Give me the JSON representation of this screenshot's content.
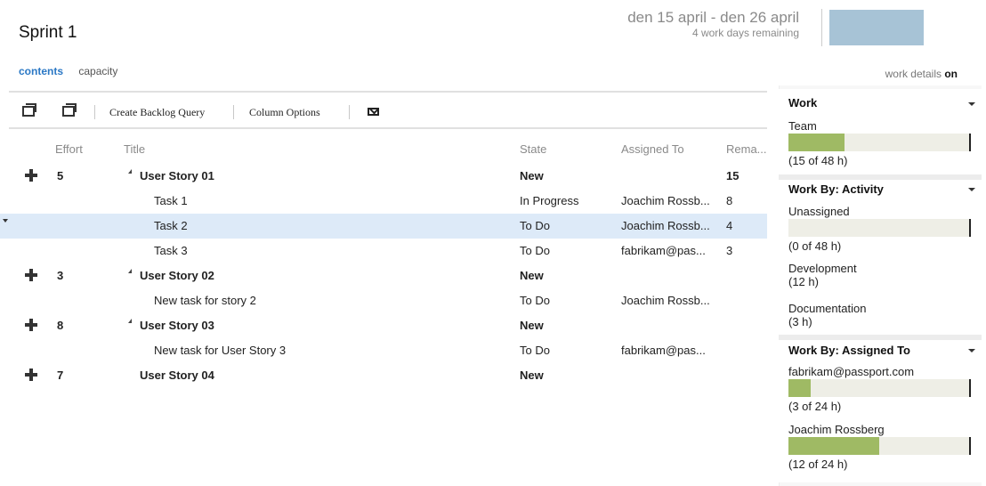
{
  "header": {
    "sprint_title": "Sprint 1",
    "date_range": "den 15 april - den 26 april",
    "days_remaining": "4 work days remaining"
  },
  "tabs": [
    {
      "label": "contents",
      "active": true
    },
    {
      "label": "capacity",
      "active": false
    }
  ],
  "work_details": {
    "label": "work details",
    "state": "on"
  },
  "toolbar": {
    "create_backlog_query": "Create Backlog Query",
    "column_options": "Column Options"
  },
  "columns": {
    "effort": "Effort",
    "title": "Title",
    "state": "State",
    "assigned_to": "Assigned To",
    "remaining": "Rema..."
  },
  "rows": [
    {
      "type": "story",
      "effort": "5",
      "title": "User Story 01",
      "state": "New",
      "assigned": "",
      "remaining": "15"
    },
    {
      "type": "task",
      "effort": "",
      "title": "Task 1",
      "state": "In Progress",
      "assigned": "Joachim Rossb...",
      "remaining": "8"
    },
    {
      "type": "task",
      "effort": "",
      "title": "Task 2",
      "state": "To Do",
      "assigned": "Joachim Rossb...",
      "remaining": "4",
      "selected": true
    },
    {
      "type": "task",
      "effort": "",
      "title": "Task 3",
      "state": "To Do",
      "assigned": "fabrikam@pas...",
      "remaining": "3"
    },
    {
      "type": "story",
      "effort": "3",
      "title": "User Story 02",
      "state": "New",
      "assigned": "",
      "remaining": ""
    },
    {
      "type": "task",
      "effort": "",
      "title": "New task for story 2",
      "state": "To Do",
      "assigned": "Joachim Rossb...",
      "remaining": ""
    },
    {
      "type": "story",
      "effort": "8",
      "title": "User Story 03",
      "state": "New",
      "assigned": "",
      "remaining": ""
    },
    {
      "type": "task",
      "effort": "",
      "title": "New task for User Story 3",
      "state": "To Do",
      "assigned": "fabrikam@pas...",
      "remaining": ""
    },
    {
      "type": "story",
      "effort": "7",
      "title": "User Story 04",
      "state": "New",
      "assigned": "",
      "remaining": ""
    }
  ],
  "work_panel": {
    "work": {
      "title": "Work",
      "team_label": "Team",
      "team_caption": "(15 of 48 h)",
      "team_fraction": 0.3125
    },
    "activity": {
      "title": "Work By: Activity",
      "unassigned_label": "Unassigned",
      "unassigned_caption": "(0 of 48 h)",
      "unassigned_fraction": 0,
      "development_label": "Development",
      "development_hours": "(12 h)",
      "documentation_label": "Documentation",
      "documentation_hours": "(3 h)"
    },
    "assigned": {
      "title": "Work By: Assigned To",
      "person1_name": "fabrikam@passport.com",
      "person1_caption": "(3 of 24 h)",
      "person1_fraction": 0.125,
      "person2_name": "Joachim Rossberg",
      "person2_caption": "(12 of 24 h)",
      "person2_fraction": 0.5
    }
  },
  "colors": {
    "accent_link": "#2b78c5",
    "bar_fill": "#9fba64",
    "burndown": "#a7c3d6",
    "selected_row": "#ddeaf8"
  }
}
